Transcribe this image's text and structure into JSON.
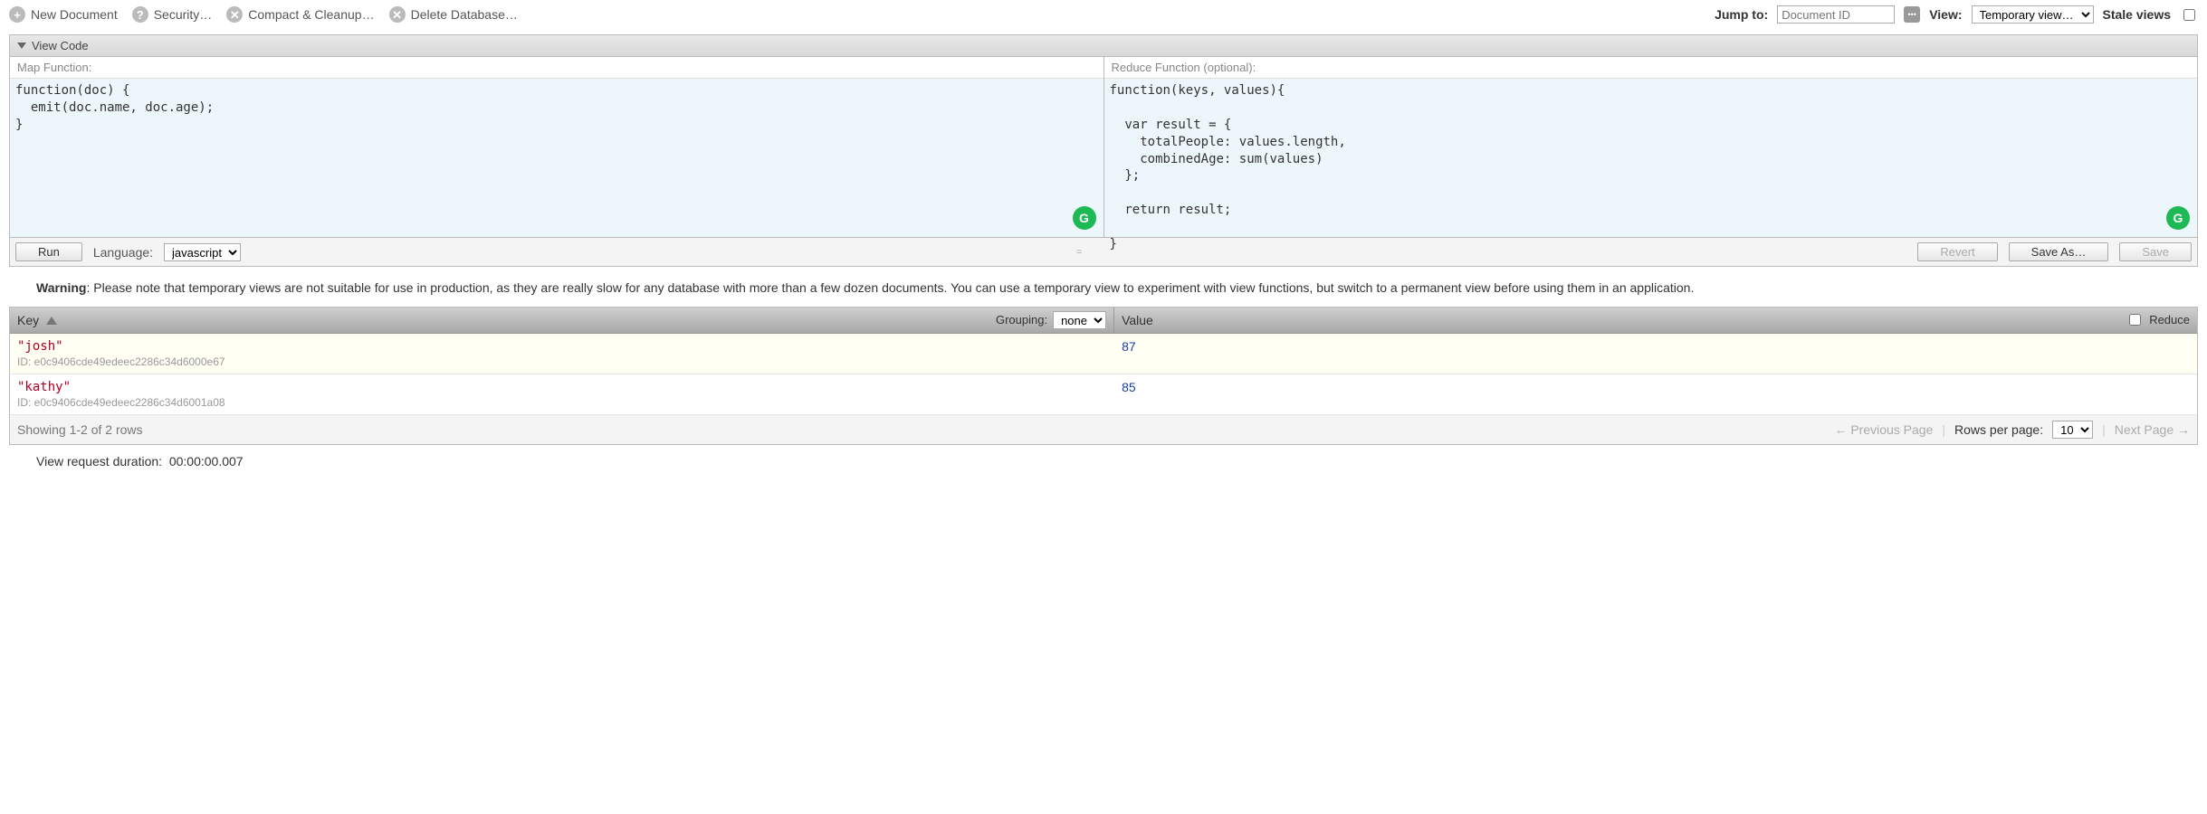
{
  "toolbar": {
    "newDoc": "New Document",
    "security": "Security…",
    "compact": "Compact & Cleanup…",
    "deleteDb": "Delete Database…",
    "jumpTo": "Jump to:",
    "docIdPlaceholder": "Document ID",
    "viewLabel": "View:",
    "viewSelected": "Temporary view…",
    "staleViews": "Stale views"
  },
  "viewCode": {
    "header": "View Code",
    "mapLabel": "Map Function:",
    "mapCode": "function(doc) {\n  emit(doc.name, doc.age);\n}",
    "reduceLabel": "Reduce Function (optional):",
    "reduceCode": "function(keys, values){\n\n  var result = {\n    totalPeople: values.length,\n    combinedAge: sum(values)\n  };\n\n  return result;\n\n}",
    "run": "Run",
    "languageLabel": "Language:",
    "languageSelected": "javascript",
    "revert": "Revert",
    "saveAs": "Save As…",
    "save": "Save",
    "separator": "="
  },
  "warning": {
    "label": "Warning",
    "text": ": Please note that temporary views are not suitable for use in production, as they are really slow for any database with more than a few dozen documents. You can use a temporary view to experiment with view functions, but switch to a permanent view before using them in an application."
  },
  "results": {
    "keyHeader": "Key",
    "groupingLabel": "Grouping:",
    "groupingSelected": "none",
    "valueHeader": "Value",
    "reduceLabel": "Reduce",
    "idPrefix": "ID: ",
    "rows": [
      {
        "key": "\"josh\"",
        "id": "e0c9406cde49edeec2286c34d6000e67",
        "value": "87"
      },
      {
        "key": "\"kathy\"",
        "id": "e0c9406cde49edeec2286c34d6001a08",
        "value": "85"
      }
    ],
    "showing": "Showing 1-2 of 2 rows",
    "prev": "← Previous Page",
    "rowsPerPageLabel": "Rows per page:",
    "rowsPerPageSelected": "10",
    "next": "Next Page →"
  },
  "duration": {
    "label": "View request duration:",
    "value": "00:00:00.007"
  }
}
